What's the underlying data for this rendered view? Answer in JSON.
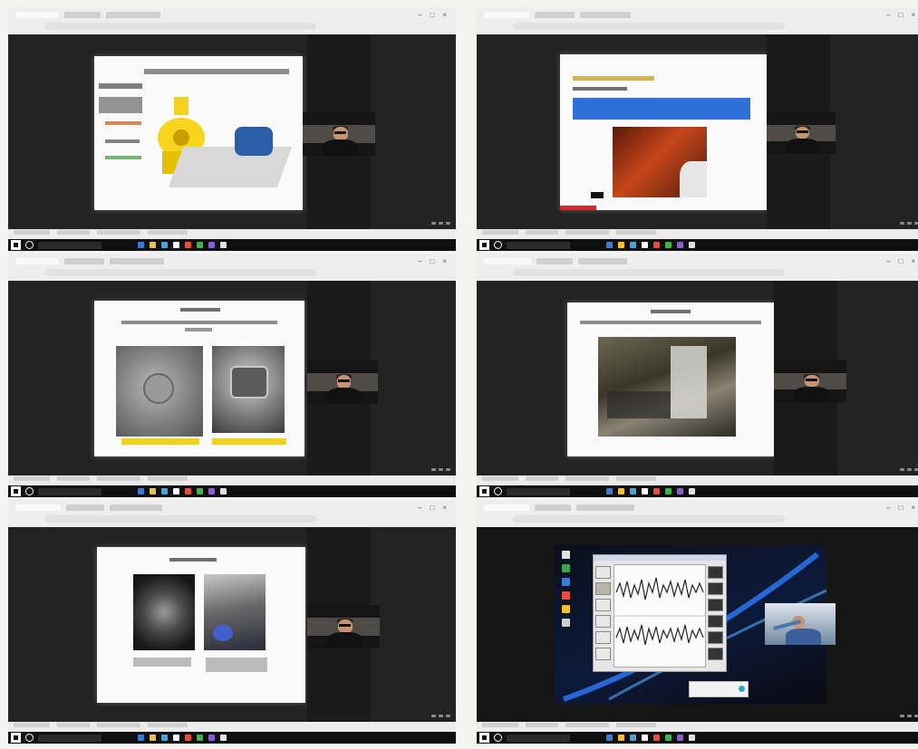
{
  "screenshots": [
    {
      "id": "shot-1",
      "slide_kind": "vibration-tests"
    },
    {
      "id": "shot-2",
      "slide_kind": "video-highlight"
    },
    {
      "id": "shot-3",
      "slide_kind": "case-study-metal"
    },
    {
      "id": "shot-4",
      "slide_kind": "case-study-factory"
    },
    {
      "id": "shot-5",
      "slide_kind": "case-study-photos"
    },
    {
      "id": "shot-6",
      "slide_kind": "oscilloscope-desktop"
    }
  ],
  "colors": {
    "slide_bg": "#fafafa",
    "yellow": "#f1d21a",
    "blue": "#2e6fd8",
    "red": "#d22b2b",
    "dark": "#232323",
    "taskbar": "#0f0f0f"
  },
  "icons": [
    "windows-start-icon",
    "cortana-icon",
    "minimize-icon",
    "maximize-icon",
    "close-icon",
    "webcam-icon"
  ]
}
